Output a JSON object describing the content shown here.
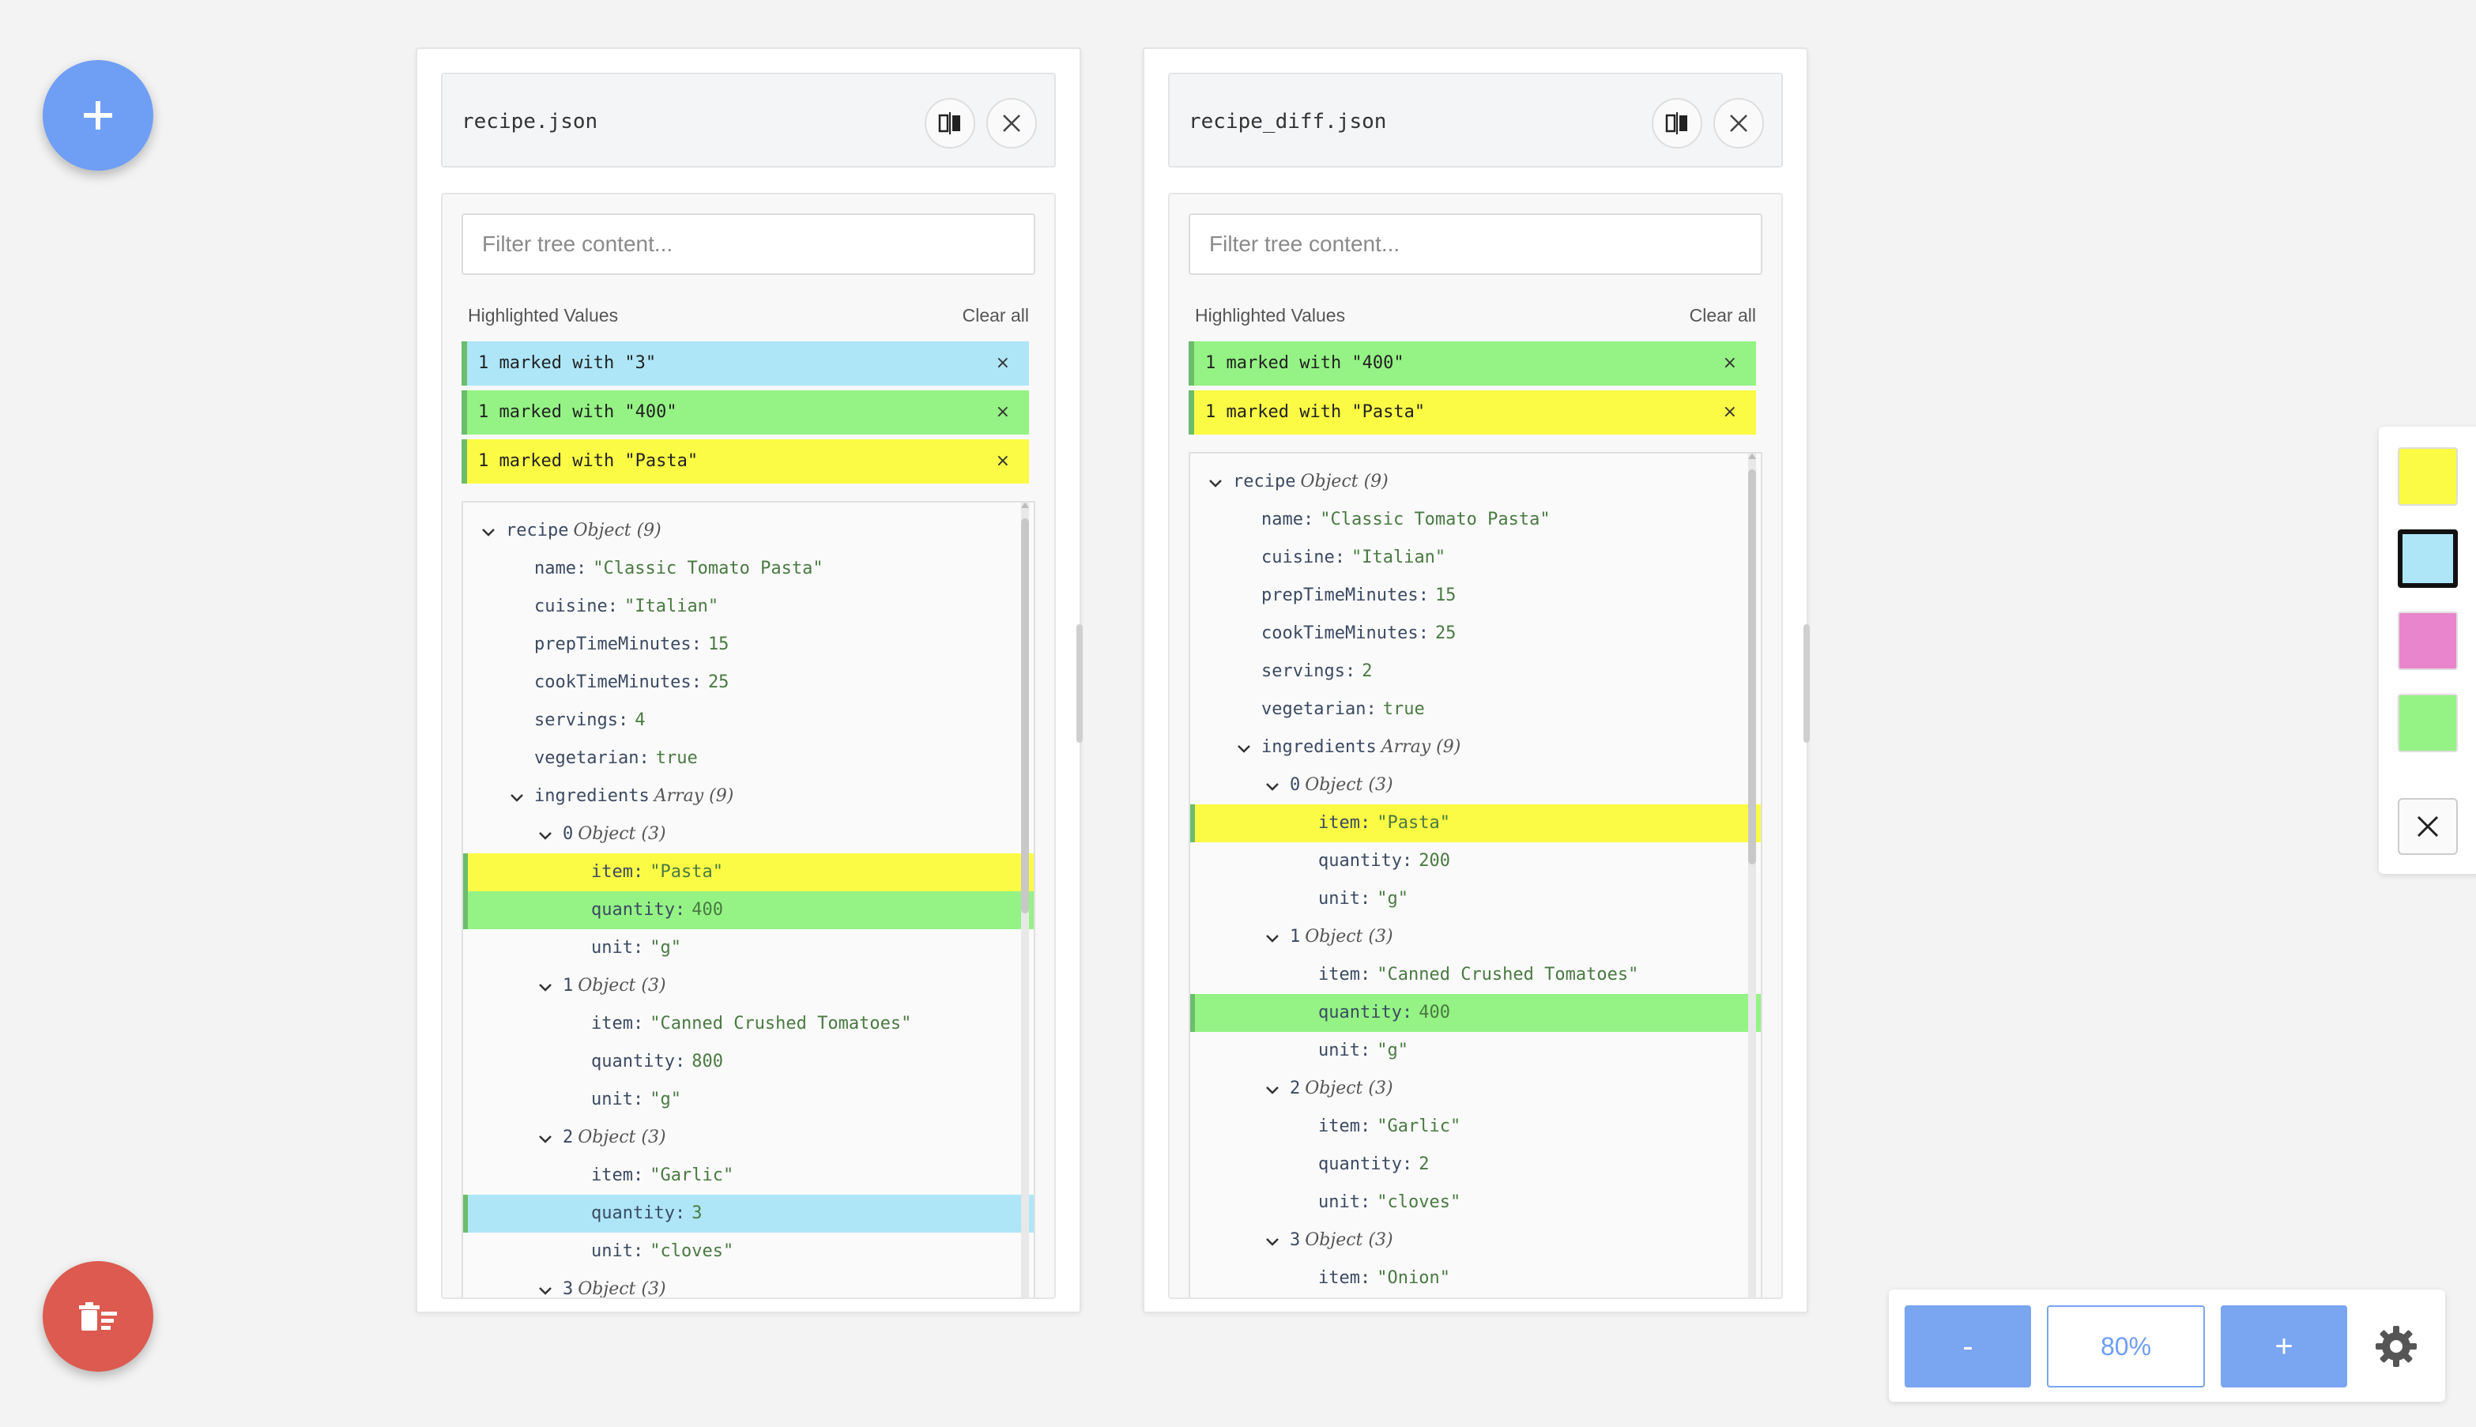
{
  "colors": {
    "accent": "#6f9ef5",
    "danger": "#dc5a4f",
    "highlight_blue": "#aee6f8",
    "highlight_green": "#94f384",
    "highlight_yellow": "#fbfb45",
    "highlight_pink": "#e985cd"
  },
  "left_panel": {
    "file_name": "recipe.json",
    "filter_placeholder": "Filter tree content...",
    "highlighted_title": "Highlighted Values",
    "clear_all": "Clear all",
    "chips": [
      {
        "text": "1 marked with \"3\"",
        "color": "#aee6f8",
        "remove": "×"
      },
      {
        "text": "1 marked with \"400\"",
        "color": "#94f384",
        "remove": "×"
      },
      {
        "text": "1 marked with \"Pasta\"",
        "color": "#fbfb45",
        "remove": "×"
      }
    ],
    "tree": [
      {
        "depth": 0,
        "expander": true,
        "key": "recipe",
        "type": "Object (9)"
      },
      {
        "depth": 1,
        "key": "name",
        "value": "\"Classic Tomato Pasta\"",
        "vtype": "s"
      },
      {
        "depth": 1,
        "key": "cuisine",
        "value": "\"Italian\"",
        "vtype": "s"
      },
      {
        "depth": 1,
        "key": "prepTimeMinutes",
        "value": "15",
        "vtype": "n"
      },
      {
        "depth": 1,
        "key": "cookTimeMinutes",
        "value": "25",
        "vtype": "n"
      },
      {
        "depth": 1,
        "key": "servings",
        "value": "4",
        "vtype": "n"
      },
      {
        "depth": 1,
        "key": "vegetarian",
        "value": "true",
        "vtype": "n"
      },
      {
        "depth": 1,
        "expander": true,
        "key": "ingredients",
        "type": "Array (9)"
      },
      {
        "depth": 2,
        "expander": true,
        "key": "0",
        "type": "Object (3)"
      },
      {
        "depth": 3,
        "key": "item",
        "value": "\"Pasta\"",
        "vtype": "s",
        "hl": "#fbfb45"
      },
      {
        "depth": 3,
        "key": "quantity",
        "value": "400",
        "vtype": "n",
        "hl": "#94f384"
      },
      {
        "depth": 3,
        "key": "unit",
        "value": "\"g\"",
        "vtype": "s"
      },
      {
        "depth": 2,
        "expander": true,
        "key": "1",
        "type": "Object (3)"
      },
      {
        "depth": 3,
        "key": "item",
        "value": "\"Canned Crushed Tomatoes\"",
        "vtype": "s"
      },
      {
        "depth": 3,
        "key": "quantity",
        "value": "800",
        "vtype": "n"
      },
      {
        "depth": 3,
        "key": "unit",
        "value": "\"g\"",
        "vtype": "s"
      },
      {
        "depth": 2,
        "expander": true,
        "key": "2",
        "type": "Object (3)"
      },
      {
        "depth": 3,
        "key": "item",
        "value": "\"Garlic\"",
        "vtype": "s"
      },
      {
        "depth": 3,
        "key": "quantity",
        "value": "3",
        "vtype": "n",
        "hl": "#aee6f8"
      },
      {
        "depth": 3,
        "key": "unit",
        "value": "\"cloves\"",
        "vtype": "s"
      },
      {
        "depth": 2,
        "expander": true,
        "key": "3",
        "type": "Object (3)"
      }
    ]
  },
  "right_panel": {
    "file_name": "recipe_diff.json",
    "filter_placeholder": "Filter tree content...",
    "highlighted_title": "Highlighted Values",
    "clear_all": "Clear all",
    "chips": [
      {
        "text": "1 marked with \"400\"",
        "color": "#94f384",
        "remove": "×"
      },
      {
        "text": "1 marked with \"Pasta\"",
        "color": "#fbfb45",
        "remove": "×"
      }
    ],
    "tree": [
      {
        "depth": 0,
        "expander": true,
        "key": "recipe",
        "type": "Object (9)"
      },
      {
        "depth": 1,
        "key": "name",
        "value": "\"Classic Tomato Pasta\"",
        "vtype": "s"
      },
      {
        "depth": 1,
        "key": "cuisine",
        "value": "\"Italian\"",
        "vtype": "s"
      },
      {
        "depth": 1,
        "key": "prepTimeMinutes",
        "value": "15",
        "vtype": "n"
      },
      {
        "depth": 1,
        "key": "cookTimeMinutes",
        "value": "25",
        "vtype": "n"
      },
      {
        "depth": 1,
        "key": "servings",
        "value": "2",
        "vtype": "n"
      },
      {
        "depth": 1,
        "key": "vegetarian",
        "value": "true",
        "vtype": "n"
      },
      {
        "depth": 1,
        "expander": true,
        "key": "ingredients",
        "type": "Array (9)"
      },
      {
        "depth": 2,
        "expander": true,
        "key": "0",
        "type": "Object (3)"
      },
      {
        "depth": 3,
        "key": "item",
        "value": "\"Pasta\"",
        "vtype": "s",
        "hl": "#fbfb45"
      },
      {
        "depth": 3,
        "key": "quantity",
        "value": "200",
        "vtype": "n"
      },
      {
        "depth": 3,
        "key": "unit",
        "value": "\"g\"",
        "vtype": "s"
      },
      {
        "depth": 2,
        "expander": true,
        "key": "1",
        "type": "Object (3)"
      },
      {
        "depth": 3,
        "key": "item",
        "value": "\"Canned Crushed Tomatoes\"",
        "vtype": "s"
      },
      {
        "depth": 3,
        "key": "quantity",
        "value": "400",
        "vtype": "n",
        "hl": "#94f384"
      },
      {
        "depth": 3,
        "key": "unit",
        "value": "\"g\"",
        "vtype": "s"
      },
      {
        "depth": 2,
        "expander": true,
        "key": "2",
        "type": "Object (3)"
      },
      {
        "depth": 3,
        "key": "item",
        "value": "\"Garlic\"",
        "vtype": "s"
      },
      {
        "depth": 3,
        "key": "quantity",
        "value": "2",
        "vtype": "n"
      },
      {
        "depth": 3,
        "key": "unit",
        "value": "\"cloves\"",
        "vtype": "s"
      },
      {
        "depth": 2,
        "expander": true,
        "key": "3",
        "type": "Object (3)"
      },
      {
        "depth": 3,
        "key": "item",
        "value": "\"Onion\"",
        "vtype": "s"
      }
    ]
  },
  "palette": {
    "swatches": [
      {
        "name": "yellow",
        "color": "#fbfb45",
        "selected": false
      },
      {
        "name": "blue",
        "color": "#aee6f8",
        "selected": true
      },
      {
        "name": "pink",
        "color": "#e985cd",
        "selected": false
      },
      {
        "name": "green",
        "color": "#94f384",
        "selected": false
      }
    ]
  },
  "zoom": {
    "minus_label": "-",
    "value": "80%",
    "plus_label": "+"
  },
  "icons": {
    "add": "plus-icon",
    "clear": "clear-list-icon",
    "compare": "compare-icon",
    "close": "close-icon",
    "settings": "gear-icon"
  }
}
